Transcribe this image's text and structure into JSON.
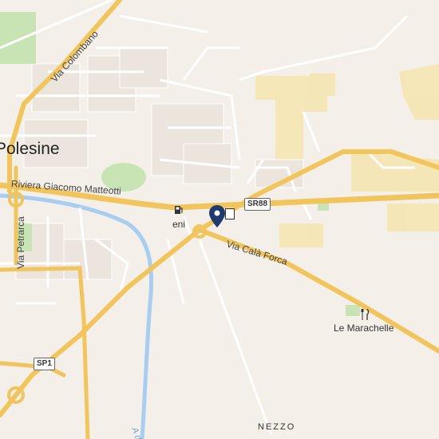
{
  "map": {
    "town_label": "Polesine",
    "roads": {
      "riviera": "Riviera Giacomo Matteotti",
      "colombano": "Via Colombano",
      "petrarca": "Via Petrarca",
      "cala_forca": "Via Calà Forca",
      "sr88": "SR88",
      "sp1": "SP1"
    },
    "pois": {
      "fuel": "eni",
      "restaurant": "Le Marachelle"
    },
    "localities": {
      "nezzo": "NEZZO"
    },
    "water": {
      "river": "A d"
    },
    "colors": {
      "land": "#f4efe9",
      "major_road": "#f2c55c",
      "minor_road": "#ffffff",
      "water": "#a7cdf0",
      "park": "#c8e4b4",
      "industrial": "#f6e5b0",
      "marker": "#1f3a6e"
    },
    "icons": {
      "fuel": "fuel-pump-icon",
      "restaurant": "fork-knife-icon",
      "marker": "location-pin-icon"
    }
  }
}
